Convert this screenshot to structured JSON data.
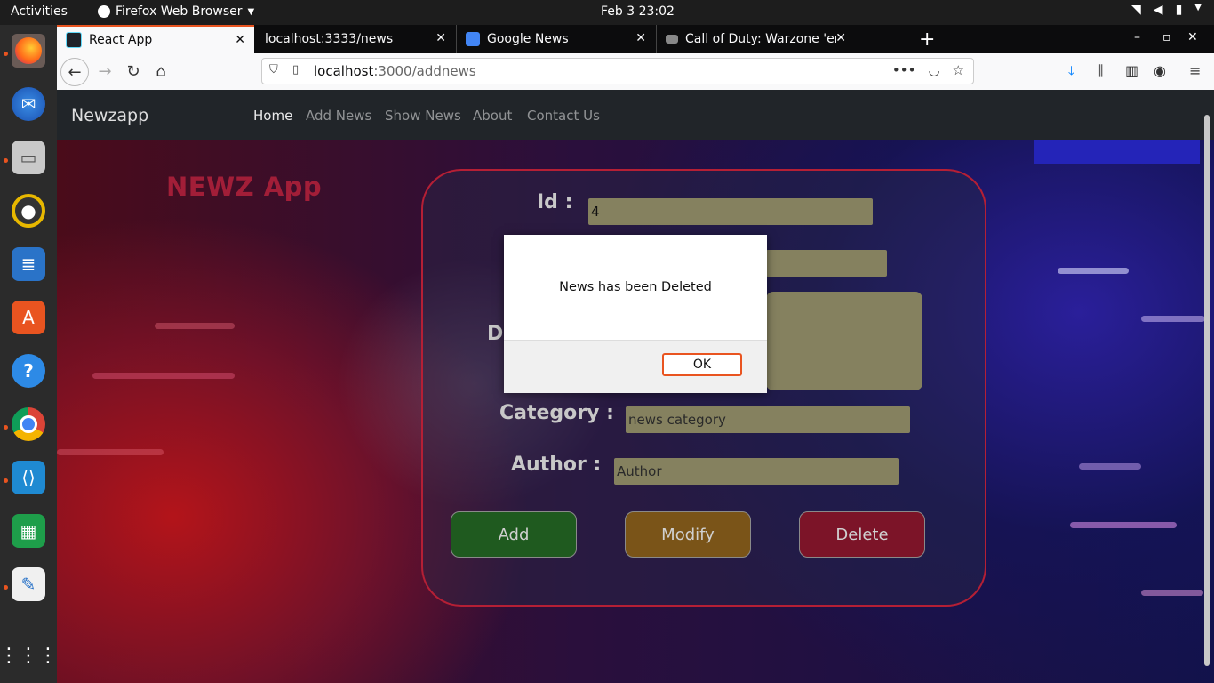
{
  "system": {
    "activities_label": "Activities",
    "app_name": "Firefox Web Browser",
    "clock": "Feb 3  23:02"
  },
  "dock": {
    "apps": [
      "firefox-icon",
      "thunderbird-icon",
      "files-icon",
      "rhythmbox-icon",
      "writer-icon",
      "software-icon",
      "help-icon",
      "chrome-icon",
      "vscode-icon",
      "calc-icon",
      "text-editor-icon",
      "show-apps-icon"
    ]
  },
  "browser": {
    "tabs": [
      {
        "title": "React App",
        "active": true
      },
      {
        "title": "localhost:3333/news",
        "active": false
      },
      {
        "title": "Google News",
        "active": false
      },
      {
        "title": "Call of Duty: Warzone 'er",
        "active": false
      }
    ],
    "url_host": "localhost",
    "url_rest": ":3000/addnews"
  },
  "app": {
    "brand": "Newzapp",
    "nav": [
      "Home",
      "Add News",
      "Show News",
      "About",
      "Contact Us"
    ],
    "hero_title": "NEWZ App",
    "form": {
      "id_label": "Id :",
      "id_value": "4",
      "desc_label_fragment": "D",
      "category_label": "Category :",
      "category_placeholder": "news category",
      "author_label": "Author :",
      "author_placeholder": "Author"
    },
    "buttons": {
      "add": "Add",
      "modify": "Modify",
      "delete": "Delete"
    },
    "button_colors": {
      "add": "#1f5a1f",
      "modify": "#7a5418",
      "delete": "#7c1428"
    }
  },
  "dialog": {
    "message": "News has been Deleted",
    "ok_label": "OK"
  }
}
